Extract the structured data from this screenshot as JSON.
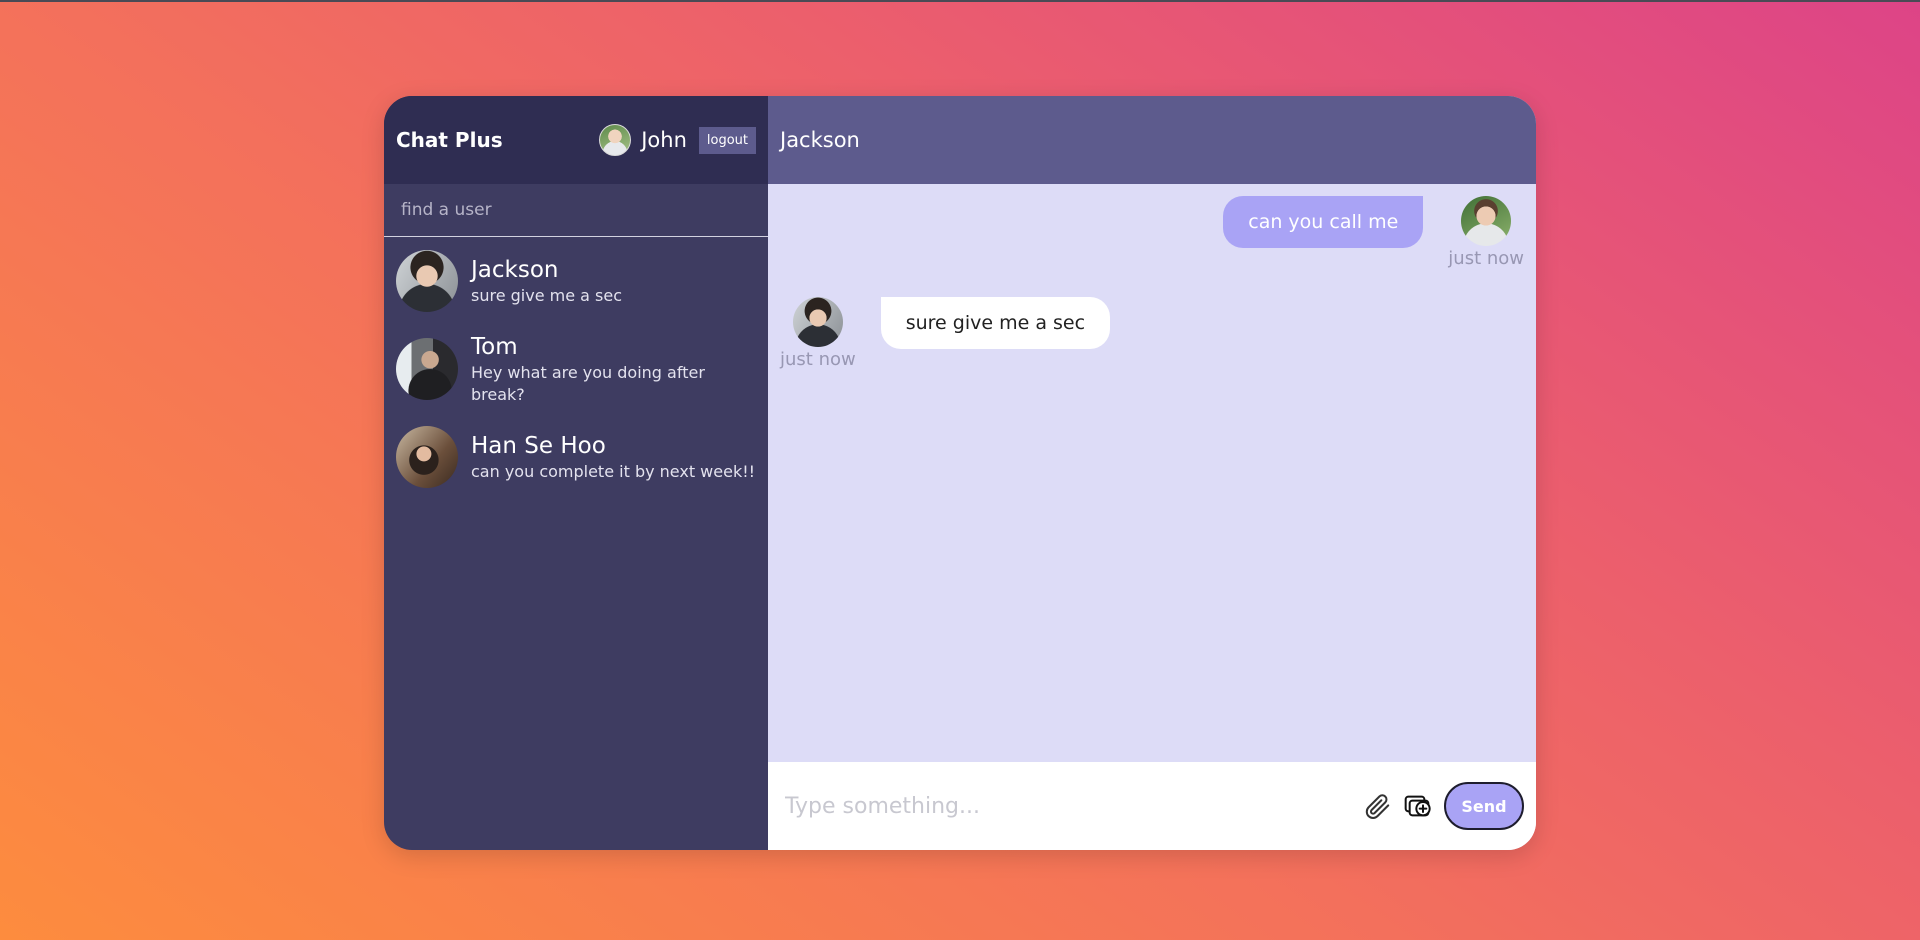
{
  "app": {
    "brand": "Chat Plus",
    "current_user": "John",
    "logout_label": "logout"
  },
  "search": {
    "placeholder": "find a user"
  },
  "chats": [
    {
      "name": "Jackson",
      "preview": "sure give me a sec"
    },
    {
      "name": "Tom",
      "preview": "Hey what are you doing after break?"
    },
    {
      "name": "Han Se Hoo",
      "preview": "can you complete it by next week!!"
    }
  ],
  "conversation": {
    "title": "Jackson",
    "messages": [
      {
        "text": "can you call me",
        "time": "just now",
        "owner": true
      },
      {
        "text": "sure give me a sec",
        "time": "just now",
        "owner": false
      }
    ]
  },
  "composer": {
    "placeholder": "Type something...",
    "send_label": "Send",
    "attach_icon": "paperclip-icon",
    "image_icon": "add-image-icon"
  },
  "colors": {
    "sidebar": "#3e3c61",
    "sidebar_header": "#2f2d52",
    "chat_header": "#5d5b8d",
    "messages_bg": "#dddcf7",
    "accent": "#a9a3f5"
  }
}
